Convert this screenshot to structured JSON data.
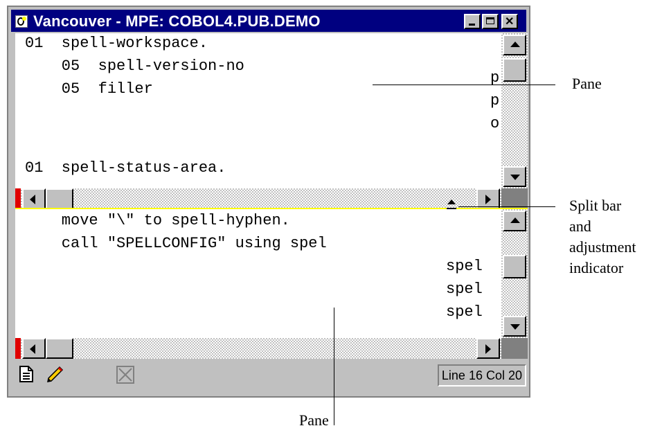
{
  "window": {
    "title": "Vancouver - MPE: COBOL4.PUB.DEMO"
  },
  "top_pane": {
    "lines": [
      "01  spell-workspace.",
      "    05  spell-version-no",
      "    05  filler",
      "",
      "",
      "01  spell-status-area."
    ],
    "right_column": [
      "p",
      "p",
      "o"
    ]
  },
  "bottom_pane": {
    "lines": [
      "    move \"\\\" to spell-hyphen.",
      "    call \"SPELLCONFIG\" using spel"
    ],
    "right_column": [
      "spel",
      "spel",
      "spel"
    ]
  },
  "status_bar": {
    "position": "Line 16 Col 20"
  },
  "annotations": {
    "top_pane_label": "Pane",
    "split_bar_label_1": "Split bar",
    "split_bar_label_2": "and",
    "split_bar_label_3": "adjustment",
    "split_bar_label_4": "indicator",
    "bottom_pane_label": "Pane"
  },
  "colors": {
    "title_bar": "#000080",
    "split_bar": "#ffff00",
    "window_face": "#c0c0c0",
    "left_margin_marker": "#e00000"
  },
  "icons": [
    "app-icon",
    "minimize-icon",
    "maximize-icon",
    "close-icon",
    "scroll-up-icon",
    "scroll-down-icon",
    "scroll-left-icon",
    "scroll-right-icon",
    "split-adjust-icon",
    "document-icon",
    "pencil-icon",
    "disabled-x-icon"
  ]
}
